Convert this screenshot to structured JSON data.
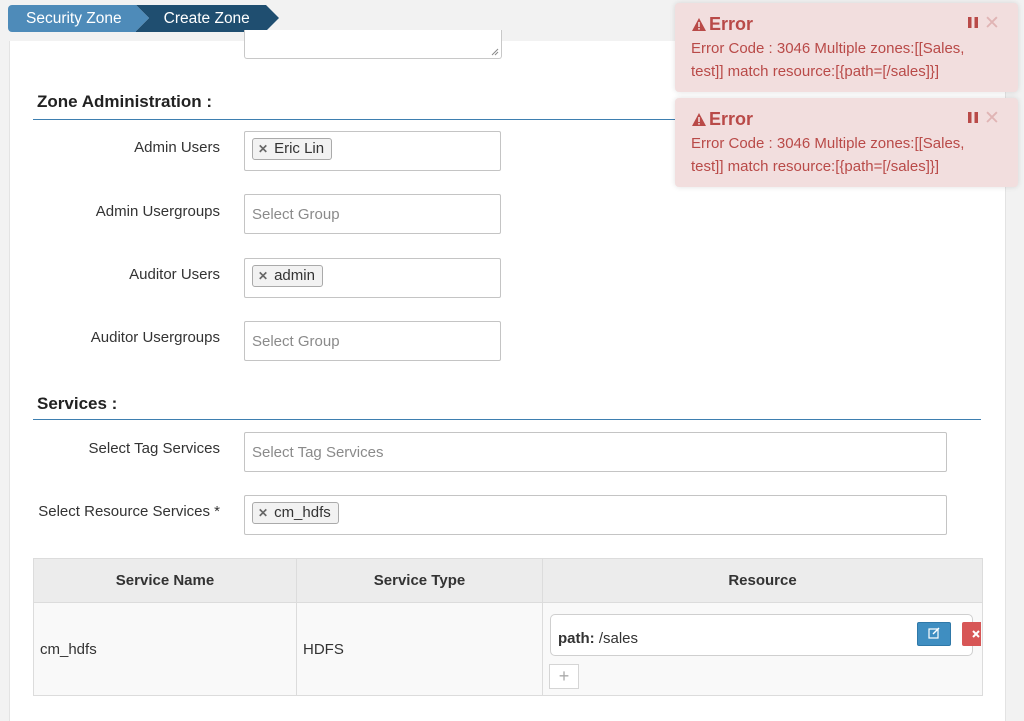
{
  "breadcrumb": {
    "items": [
      {
        "label": "Security Zone"
      },
      {
        "label": "Create Zone"
      }
    ]
  },
  "zone_admin": {
    "title": "Zone Administration :",
    "admin_users": {
      "label": "Admin Users",
      "tags": [
        "Eric Lin"
      ]
    },
    "admin_usergroups": {
      "label": "Admin Usergroups",
      "placeholder": "Select Group"
    },
    "auditor_users": {
      "label": "Auditor Users",
      "tags": [
        "admin"
      ]
    },
    "auditor_usergroups": {
      "label": "Auditor Usergroups",
      "placeholder": "Select Group"
    }
  },
  "services": {
    "title": "Services :",
    "tag_services": {
      "label": "Select Tag Services",
      "placeholder": "Select Tag Services"
    },
    "resource_services": {
      "label": "Select Resource Services *",
      "tags": [
        "cm_hdfs"
      ]
    }
  },
  "table": {
    "headers": [
      "Service Name",
      "Service Type",
      "Resource"
    ],
    "rows": [
      {
        "service_name": "cm_hdfs",
        "service_type": "HDFS",
        "resource_key": "path:",
        "resource_value": "/sales"
      }
    ]
  },
  "toasts": [
    {
      "title": "Error",
      "message": "Error Code : 3046 Multiple zones:[[Sales, test]] match resource:[{path=[/sales]}]"
    },
    {
      "title": "Error",
      "message": "Error Code : 3046 Multiple zones:[[Sales, test]] match resource:[{path=[/sales]}]"
    }
  ],
  "colors": {
    "breadcrumb_inactive": "#4e8bb9",
    "breadcrumb_active": "#1f4e70",
    "section_line": "#3e7fb0",
    "toast_bg": "#f2dede",
    "toast_text": "#b94a48",
    "edit_button": "#3f8ec1",
    "delete_button": "#d75656"
  }
}
